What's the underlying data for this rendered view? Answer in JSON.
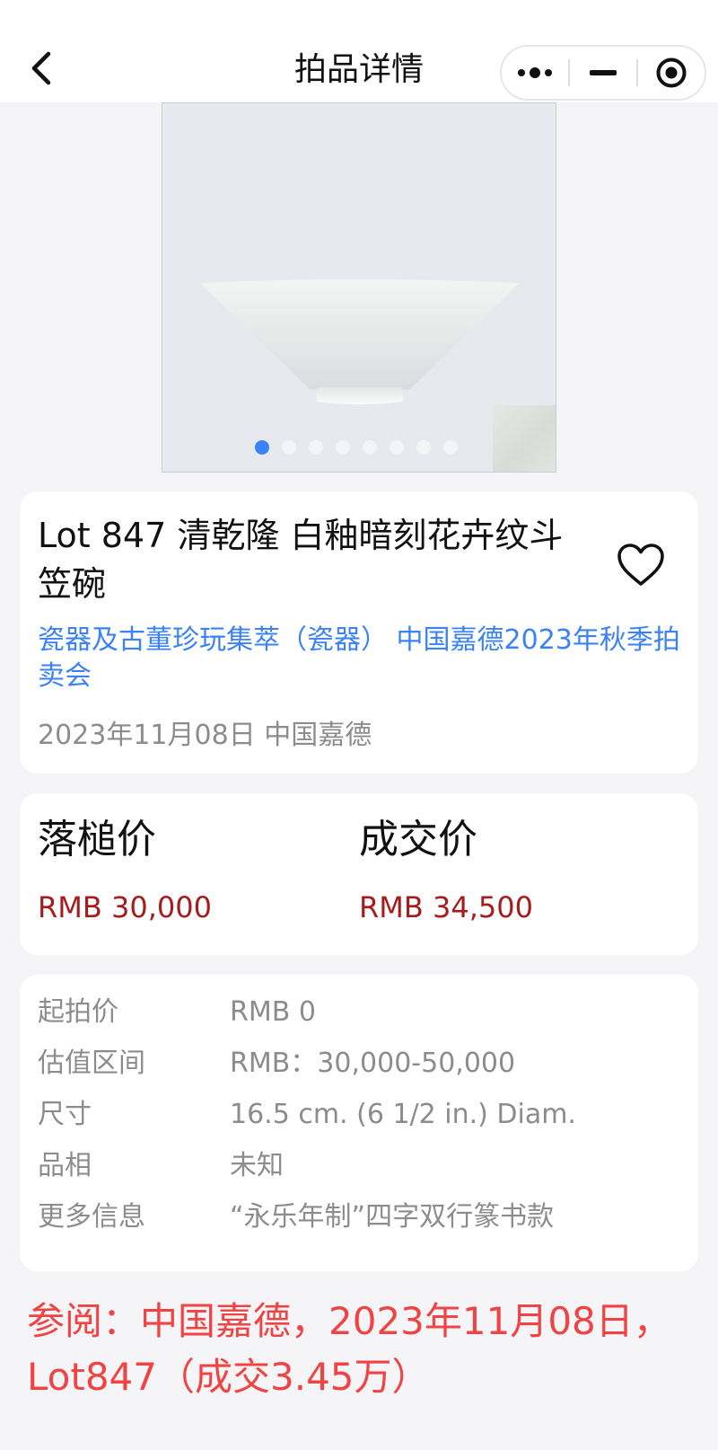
{
  "nav": {
    "title": "拍品详情"
  },
  "icons": {
    "back": "back-chevron-icon",
    "more": "more-dots-icon",
    "minimize": "minimize-icon",
    "close": "target-close-icon",
    "favorite": "heart-outline-icon"
  },
  "carousel": {
    "slide_count": 8,
    "active_index": 0
  },
  "lot": {
    "title": "Lot 847 清乾隆 白釉暗刻花卉纹斗笠碗",
    "sale_link": "瓷器及古董珍玩集萃（瓷器） 中国嘉德2023年秋季拍卖会",
    "date_house": "2023年11月08日 中国嘉德"
  },
  "prices": {
    "hammer_label": "落槌价",
    "hammer_value": "RMB 30,000",
    "sold_label": "成交价",
    "sold_value": "RMB 34,500"
  },
  "info": [
    {
      "key": "起拍价",
      "value": "RMB 0"
    },
    {
      "key": "估值区间",
      "value": "RMB：30,000-50,000"
    },
    {
      "key": "尺寸",
      "value": "16.5 cm. (6 1/2 in.) Diam."
    },
    {
      "key": "品相",
      "value": "未知"
    },
    {
      "key": "更多信息",
      "value": "“永乐年制”四字双行篆书款"
    }
  ],
  "reference_note": "参阅：中国嘉德，2023年11月08日，Lot847（成交3.45万）",
  "colors": {
    "accent_blue": "#3b82f6",
    "price_red": "#a61c1c",
    "note_red": "#f04343",
    "muted_gray": "#8c8c8c",
    "page_bg": "#f5f5f7"
  }
}
